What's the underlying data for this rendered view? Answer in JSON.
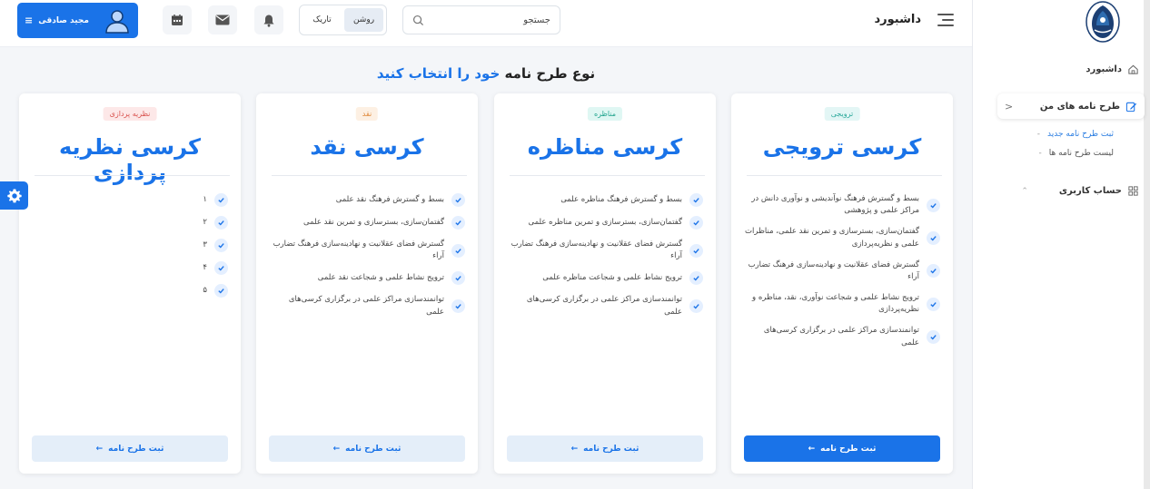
{
  "header": {
    "title": "داشبورد",
    "search_placeholder": "جستجو",
    "theme": {
      "light_label": "روشن",
      "dark_label": "تاریک",
      "selected": "روشن"
    },
    "icons": [
      "bell-icon",
      "mail-icon",
      "calendar-icon"
    ],
    "user": {
      "name": "مجید صادقی",
      "menu_icon": "≡"
    }
  },
  "sidebar": {
    "items": [
      {
        "label": "داشبورد",
        "icon": "home-icon"
      },
      {
        "label": "طرح نامه های من",
        "icon": "edit-icon",
        "chevron": "<",
        "active": true,
        "sub": [
          {
            "label": "ثبت طرح نامه جدید",
            "active": true
          },
          {
            "label": "لیست طرح نامه ها",
            "active": false
          }
        ]
      },
      {
        "label": "حساب کاربری",
        "icon": "grid-icon"
      }
    ]
  },
  "main": {
    "heading_part1": "نوع طرح نامه ",
    "heading_highlight": "خود را انتخاب کنید",
    "cards": [
      {
        "badge": "ترویجی",
        "title": "کرسی ترویجی",
        "features": [
          "بسط و گسترش فرهنگ نوآندیشی و نوآوری دانش در مراکز علمی و پژوهشی",
          "گفتمان‌سازی، بسترسازی و تمرین نقد علمی، مناظرات علمی و نظریه‌پردازی",
          "گسترش فضای عقلانیت و نهادینه‌سازی فرهنگ تضارب آراء",
          "ترویج نشاط علمی و شجاعت نوآوری، نقد، مناظره و نظریه‌پردازی",
          "توانمندسازی مراکز علمی در برگزاری کرسی‌های علمی"
        ],
        "button": "ثبت طرح نامه",
        "badge_bg": "#e3f6f5",
        "badge_fg": "#2aa89a"
      },
      {
        "badge": "مناظره",
        "title": "کرسی مناظره",
        "features": [
          "بسط و گسترش فرهنگ مناظره علمی",
          "گفتمان‌سازی، بسترسازی و تمرین مناظره علمی",
          "گسترش فضای عقلانیت و نهادینه‌سازی فرهنگ تضارب آراء",
          "ترویج نشاط علمی و شجاعت مناظره علمی",
          "توانمندسازی مراکز علمی در برگزاری کرسی‌های علمی"
        ],
        "button": "ثبت طرح نامه",
        "badge_bg": "#dff7f3",
        "badge_fg": "#23a58f"
      },
      {
        "badge": "نقد",
        "title": "کرسی نقد",
        "features": [
          "بسط و گسترش فرهنگ نقد علمی",
          "گفتمان‌سازی، بسترسازی و تمرین نقد علمی",
          "گسترش فضای عقلانیت و نهادینه‌سازی فرهنگ تضارب آراء",
          "ترویج نشاط علمی و شجاعت نقد علمی",
          "توانمندسازی مراکز علمی در برگزاری کرسی‌های علمی"
        ],
        "button": "ثبت طرح نامه",
        "badge_bg": "#fdf0e3",
        "badge_fg": "#e08a3c"
      },
      {
        "badge": "نظریه پردازی",
        "title": "کرسی نظریه پردازی",
        "features": [
          "۱",
          "۲",
          "۳",
          "۴",
          "۵"
        ],
        "button": "ثبت طرح نامه",
        "badge_bg": "#fde8e8",
        "badge_fg": "#d9534f"
      }
    ]
  },
  "colors": {
    "accent": "#1a73e8",
    "check_bg": "#e4efff",
    "button_light": "#e4eef9"
  }
}
